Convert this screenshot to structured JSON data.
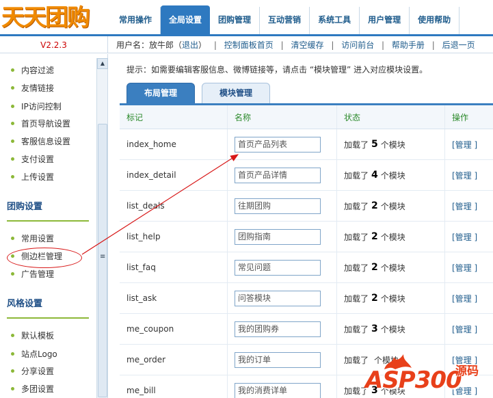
{
  "header": {
    "logo_text": "天天团购",
    "nav_tabs": [
      {
        "label": "常用操作",
        "active": false
      },
      {
        "label": "全局设置",
        "active": true
      },
      {
        "label": "团购管理",
        "active": false
      },
      {
        "label": "互动营销",
        "active": false
      },
      {
        "label": "系统工具",
        "active": false
      },
      {
        "label": "用户管理",
        "active": false
      },
      {
        "label": "使用帮助",
        "active": false
      }
    ]
  },
  "subbar": {
    "version": "V2.2.3",
    "user_prefix": "用户名：放牛郎（",
    "logout": "退出",
    "user_suffix": "）",
    "links": [
      "控制面板首页",
      "清空缓存",
      "访问前台",
      "帮助手册",
      "后退一页"
    ],
    "separator": "|"
  },
  "sidebar": {
    "items_top": [
      "内容过滤",
      "友情链接",
      "IP访问控制",
      "首页导航设置",
      "客服信息设置",
      "支付设置",
      "上传设置"
    ],
    "section_group": "团购设置",
    "items_group": [
      "常用设置",
      "侧边栏管理",
      "广告管理"
    ],
    "section_style": "风格设置",
    "items_style": [
      "默认模板",
      "站点Logo",
      "分享设置",
      "多团设置"
    ],
    "scroll_up_glyph": "▲",
    "scroll_grip_glyph": "≡"
  },
  "main": {
    "hint": "提示：如需要编辑客服信息、微博链接等，请点击 “模块管理” 进入对应模块设置。",
    "tabs": [
      {
        "label": "布局管理",
        "active": true
      },
      {
        "label": "模块管理",
        "active": false
      }
    ],
    "columns": [
      "标记",
      "名称",
      "状态",
      "操作"
    ],
    "status_prefix": "加载了",
    "status_suffix": "个模块",
    "manage_label": "[管理 ]",
    "rows": [
      {
        "mark": "index_home",
        "name": "首页产品列表",
        "count": "5"
      },
      {
        "mark": "index_detail",
        "name": "首页产品详情",
        "count": "4"
      },
      {
        "mark": "list_deals",
        "name": "往期团购",
        "count": "2"
      },
      {
        "mark": "list_help",
        "name": "团购指南",
        "count": "2"
      },
      {
        "mark": "list_faq",
        "name": "常见问题",
        "count": "2"
      },
      {
        "mark": "list_ask",
        "name": "问答模块",
        "count": "2"
      },
      {
        "mark": "me_coupon",
        "name": "我的团购券",
        "count": "3"
      },
      {
        "mark": "me_order",
        "name": "我的订单",
        "count": ""
      },
      {
        "mark": "me_bill",
        "name": "我的消费详单",
        "count": "3"
      }
    ]
  },
  "watermark": {
    "brand": "ASP300",
    "cn": "源码"
  },
  "colors": {
    "accent": "#2e79c0",
    "logo": "#f08a00",
    "version": "#cc0000",
    "dot": "#8cb838",
    "annotation": "#d81818",
    "header_green": "#2c8a2c"
  }
}
